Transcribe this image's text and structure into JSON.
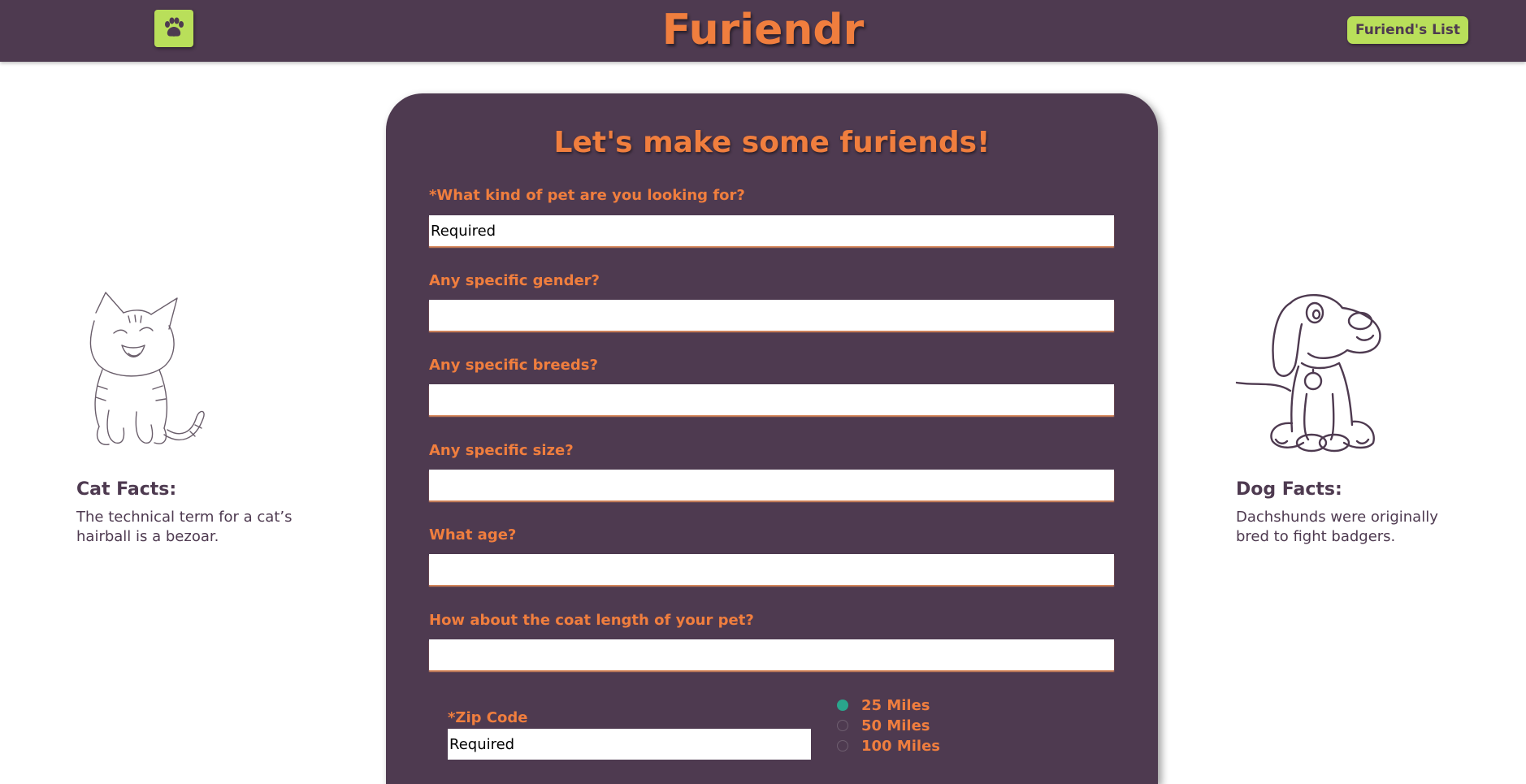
{
  "header": {
    "logo_icon": "paw-icon",
    "brand": "Furiendr",
    "list_button": "Furiend's List"
  },
  "colors": {
    "header_bg": "#4e3a50",
    "accent_orange": "#f07e3e",
    "accent_green": "#b9df5a",
    "radio_selected": "#2aa58c"
  },
  "form": {
    "title": "Let's make some furiends!",
    "questions": [
      {
        "label": "*What kind of pet are you looking for?",
        "placeholder": "Required"
      },
      {
        "label": "Any specific gender?",
        "placeholder": ""
      },
      {
        "label": "Any specific breeds?",
        "placeholder": ""
      },
      {
        "label": "Any specific size?",
        "placeholder": ""
      },
      {
        "label": "What age?",
        "placeholder": ""
      },
      {
        "label": "How about the coat length of your pet?",
        "placeholder": ""
      }
    ],
    "zip": {
      "label": "*Zip Code",
      "placeholder": "Required"
    },
    "distance": {
      "options": [
        "25 Miles",
        "50 Miles",
        "100 Miles"
      ],
      "selected": "25 Miles"
    }
  },
  "cat": {
    "image_icon": "cat-illustration",
    "title": "Cat Facts:",
    "fact": "The technical term for a cat’s hairball is a bezoar."
  },
  "dog": {
    "image_icon": "dog-illustration",
    "title": "Dog Facts:",
    "fact": "Dachshunds were originally bred to fight badgers."
  }
}
